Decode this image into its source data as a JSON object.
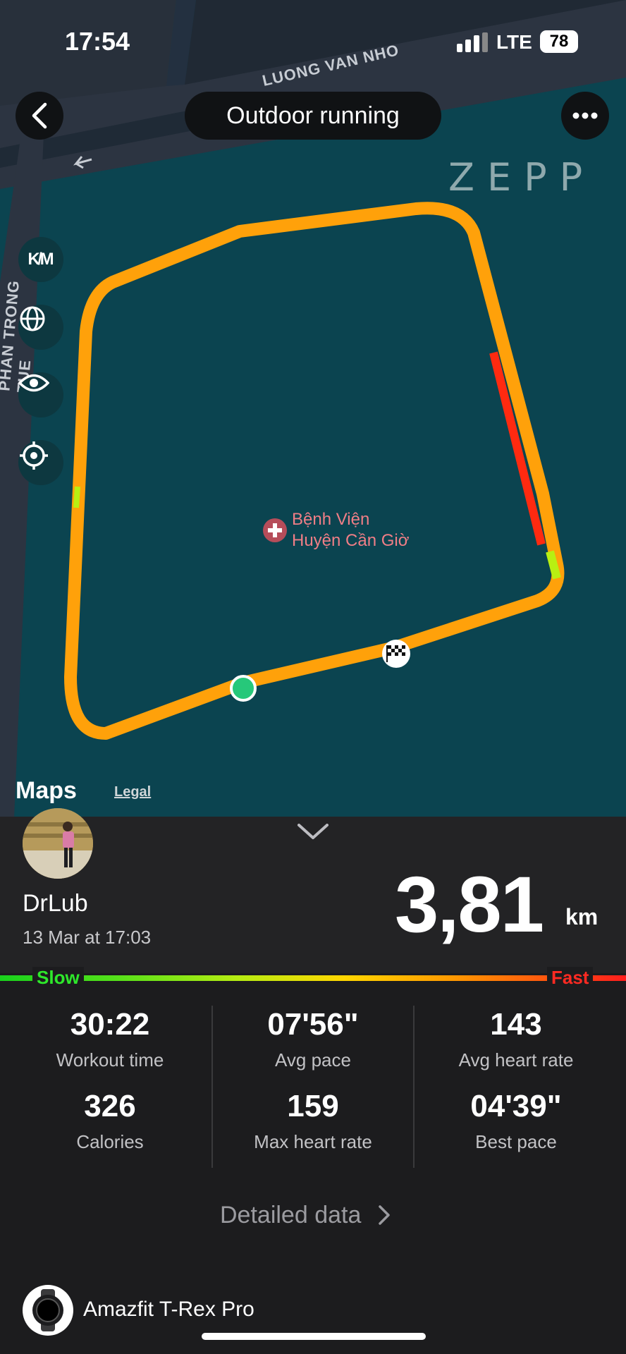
{
  "status_bar": {
    "time": "17:54",
    "network": "LTE",
    "battery": "78"
  },
  "header": {
    "title": "Outdoor running",
    "brand": "ZEPP"
  },
  "map": {
    "streets": [
      "LUONG VAN NHO",
      "PHAN TRONG TUE"
    ],
    "poi": {
      "line1": "Bệnh Viện",
      "line2": "Huyện Cần Giờ"
    },
    "attribution": "Maps",
    "legal": "Legal",
    "tools": [
      "km-toggle-icon",
      "globe-icon",
      "eye-icon",
      "locate-icon"
    ],
    "route_colors": {
      "main": "#ffa10a",
      "fast": "#ff2a10",
      "slow": "#b8ef12",
      "start": "#27c87a"
    }
  },
  "user": {
    "name": "DrLub",
    "date": "13 Mar at 17:03"
  },
  "distance": {
    "value": "3,81",
    "unit": "km"
  },
  "pace_scale": {
    "slow": "Slow",
    "fast": "Fast"
  },
  "stats": [
    {
      "value": "30:22",
      "label": "Workout time"
    },
    {
      "value": "07'56\"",
      "label": "Avg pace"
    },
    {
      "value": "143",
      "label": "Avg heart rate"
    },
    {
      "value": "326",
      "label": "Calories"
    },
    {
      "value": "159",
      "label": "Max heart rate"
    },
    {
      "value": "04'39\"",
      "label": "Best pace"
    }
  ],
  "detailed_link": "Detailed data",
  "device": {
    "name": "Amazfit T-Rex Pro"
  }
}
